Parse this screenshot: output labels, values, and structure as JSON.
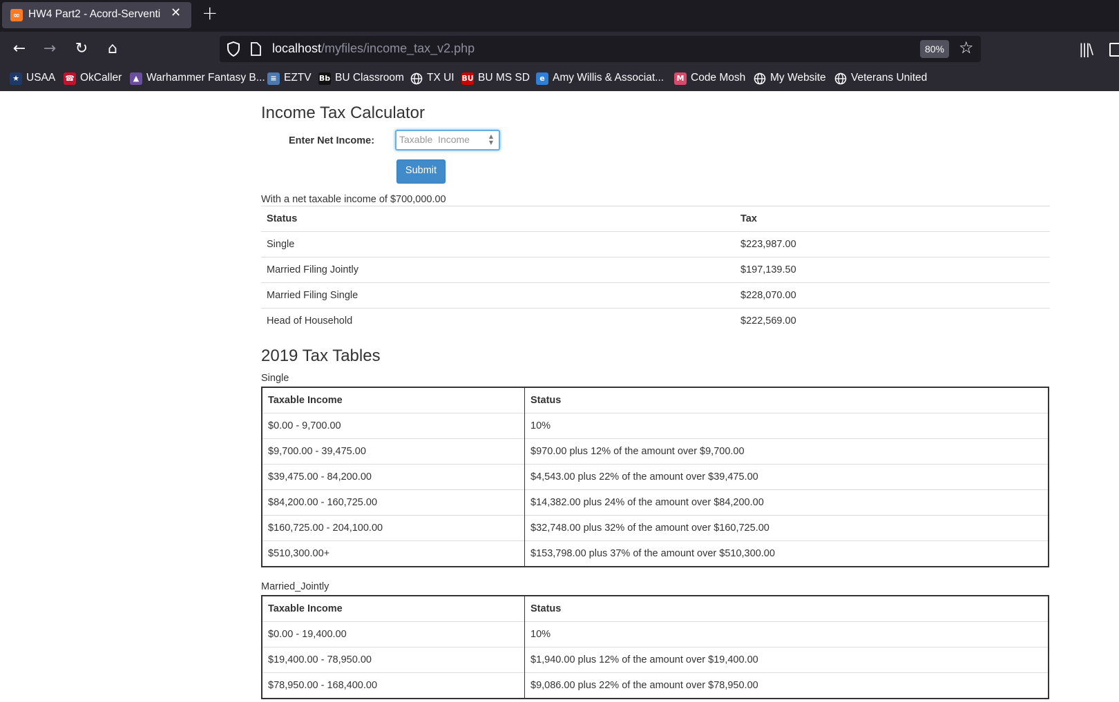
{
  "browser": {
    "tab": {
      "title": "HW4 Part2 - Acord-Serventi",
      "favicon": "xampp-icon"
    },
    "url": {
      "host": "localhost",
      "path": "/myfiles/income_tax_v2.php"
    },
    "zoom": "80%",
    "bookmarks": [
      {
        "label": "USAA",
        "icon": "usaa-icon",
        "color": "#1e3a6b"
      },
      {
        "label": "OkCaller",
        "icon": "okcaller-icon",
        "color": "#c8102e"
      },
      {
        "label": "Warhammer Fantasy B...",
        "icon": "warhammer-icon",
        "color": "#6a4fa0"
      },
      {
        "label": "EZTV",
        "icon": "eztv-icon",
        "color": "#4a7ab5"
      },
      {
        "label": "BU Classroom",
        "icon": "blackboard-icon",
        "color": "#111111"
      },
      {
        "label": "TX UI",
        "icon": "globe-icon",
        "color": ""
      },
      {
        "label": "BU MS SD",
        "icon": "bu-icon",
        "color": "#cc0000"
      },
      {
        "label": "Amy Willis & Associat...",
        "icon": "edge-icon",
        "color": "#2f7fd8"
      },
      {
        "label": "Code Mosh",
        "icon": "codemosh-icon",
        "color": "#d64a6b"
      },
      {
        "label": "My Website",
        "icon": "globe-icon",
        "color": ""
      },
      {
        "label": "Veterans United",
        "icon": "globe-icon",
        "color": ""
      }
    ]
  },
  "page": {
    "title": "Income Tax Calculator",
    "form": {
      "label": "Enter Net Income:",
      "placeholder": "Taxable  Income",
      "submit": "Submit"
    },
    "result": {
      "caption": "With a net taxable income of $700,000.00",
      "headers": [
        "Status",
        "Tax"
      ],
      "rows": [
        [
          "Single",
          "$223,987.00"
        ],
        [
          "Married Filing Jointly",
          "$197,139.50"
        ],
        [
          "Married Filing Single",
          "$228,070.00"
        ],
        [
          "Head of Household",
          "$222,569.00"
        ]
      ]
    },
    "tables_title": "2019 Tax Tables",
    "tables": [
      {
        "caption": "Single",
        "headers": [
          "Taxable Income",
          "Status"
        ],
        "rows": [
          [
            "$0.00 - 9,700.00",
            "10%"
          ],
          [
            "$9,700.00 - 39,475.00",
            "$970.00 plus 12% of the amount over $9,700.00"
          ],
          [
            "$39,475.00 - 84,200.00",
            "$4,543.00 plus 22% of the amount over $39,475.00"
          ],
          [
            "$84,200.00 - 160,725.00",
            "$14,382.00 plus 24% of the amount over $84,200.00"
          ],
          [
            "$160,725.00 - 204,100.00",
            "$32,748.00 plus 32% of the amount over $160,725.00"
          ],
          [
            "$510,300.00+",
            "$153,798.00 plus 37% of the amount over $510,300.00"
          ]
        ]
      },
      {
        "caption": "Married_Jointly",
        "headers": [
          "Taxable Income",
          "Status"
        ],
        "rows": [
          [
            "$0.00 - 19,400.00",
            "10%"
          ],
          [
            "$19,400.00 - 78,950.00",
            "$1,940.00 plus 12% of the amount over $19,400.00"
          ],
          [
            "$78,950.00 - 168,400.00",
            "$9,086.00 plus 22% of the amount over $78,950.00"
          ]
        ]
      }
    ]
  }
}
